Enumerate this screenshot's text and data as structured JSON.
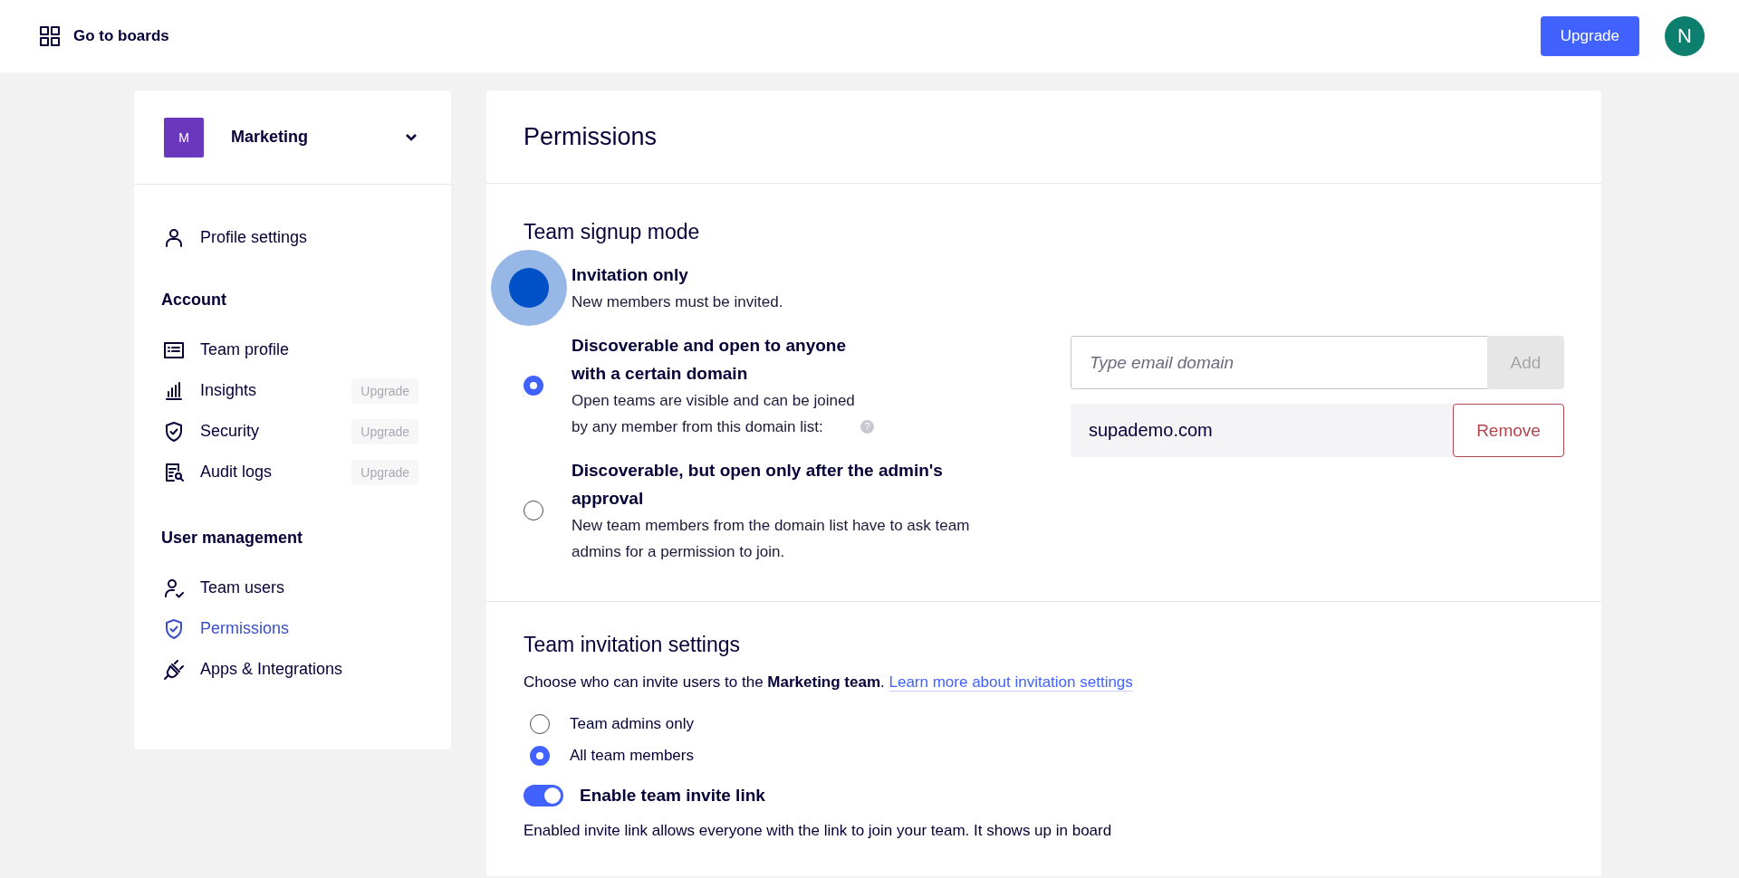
{
  "topbar": {
    "boards_link": "Go to boards",
    "upgrade_button": "Upgrade",
    "avatar_initial": "N"
  },
  "sidebar": {
    "team": {
      "initial": "M",
      "name": "Marketing"
    },
    "sections": [
      {
        "items": [
          {
            "label": "Profile settings",
            "selected": false
          }
        ]
      },
      {
        "heading": "Account",
        "items": [
          {
            "label": "Team profile",
            "selected": false
          },
          {
            "label": "Insights",
            "badge": "Upgrade",
            "selected": false
          },
          {
            "label": "Security",
            "badge": "Upgrade",
            "selected": false
          },
          {
            "label": "Audit logs",
            "badge": "Upgrade",
            "selected": false
          }
        ]
      },
      {
        "heading": "User management",
        "items": [
          {
            "label": "Team users",
            "selected": false
          },
          {
            "label": "Permissions",
            "selected": true
          },
          {
            "label": "Apps & Integrations",
            "selected": false
          }
        ]
      }
    ]
  },
  "main": {
    "title": "Permissions",
    "signup": {
      "heading": "Team signup mode",
      "options": [
        {
          "title": "Invitation only",
          "description": "New members must be invited.",
          "selected": false,
          "highlighted": true
        },
        {
          "title": "Discoverable and open to anyone with a certain domain",
          "description": "Open teams are visible and can be joined by any member from this domain list:",
          "selected": true,
          "help_mark": "?"
        },
        {
          "title": "Discoverable, but open only after the admin's approval",
          "description": "New team members from the domain list have to ask team admins for a permission to join.",
          "selected": false
        }
      ],
      "domain_input": {
        "placeholder": "Type email domain"
      },
      "add_button": {
        "label": "Add",
        "disabled": true
      },
      "domains": [
        {
          "domain": "supademo.com",
          "remove_button": "Remove"
        }
      ]
    },
    "invitation": {
      "heading": "Team invitation settings",
      "intro": "Choose who can invite users to the **Marketing team**.",
      "link": "Learn more about invitation settings",
      "options": [
        {
          "label": "Team admins only",
          "selected": false
        },
        {
          "label": "All team members",
          "selected": true
        }
      ],
      "invite_link": {
        "label": "Enable team invite link",
        "on": true,
        "description": "Enabled invite link allows everyone with the link to join your team. It shows up in board"
      }
    }
  }
}
